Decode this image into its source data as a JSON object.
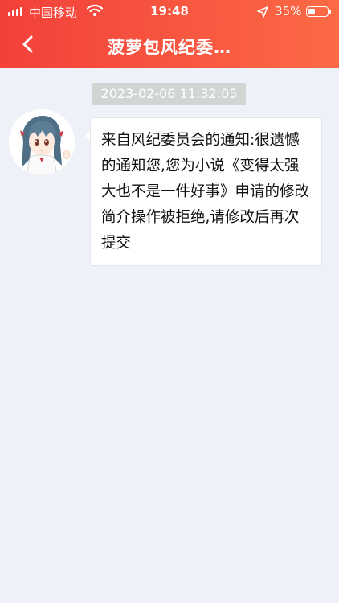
{
  "status_bar": {
    "carrier": "中国移动",
    "time": "19:48",
    "battery": "35%"
  },
  "nav": {
    "title": "菠萝包风纪委…"
  },
  "messages": [
    {
      "timestamp": "2023-02-06 11:32:05",
      "text": "来自风纪委员会的通知:很遗憾的通知您,您为小说《变得太强大也不是一件好事》申请的修改简介操作被拒绝,请修改后再次提交"
    }
  ],
  "colors": {
    "header_start": "#f3403a",
    "header_end": "#fb6a45",
    "background": "#eef1f7",
    "timestamp_bg": "#cfd6d3"
  },
  "icons": [
    "signal-icon",
    "wifi-icon",
    "location-icon",
    "battery-icon",
    "back-arrow-icon",
    "avatar"
  ]
}
